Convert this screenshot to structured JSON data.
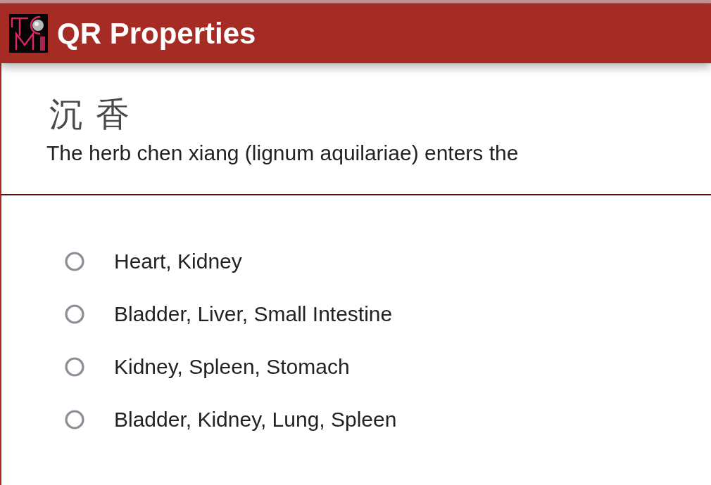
{
  "header": {
    "title": "QR Properties"
  },
  "question": {
    "herb_name": "沉香",
    "text": "The herb chen xiang (lignum aquilariae) enters the"
  },
  "options": [
    {
      "label": "Heart, Kidney",
      "selected": false
    },
    {
      "label": "Bladder, Liver, Small Intestine",
      "selected": false
    },
    {
      "label": "Kidney, Spleen, Stomach",
      "selected": false
    },
    {
      "label": "Bladder, Kidney, Lung, Spleen",
      "selected": false
    }
  ]
}
